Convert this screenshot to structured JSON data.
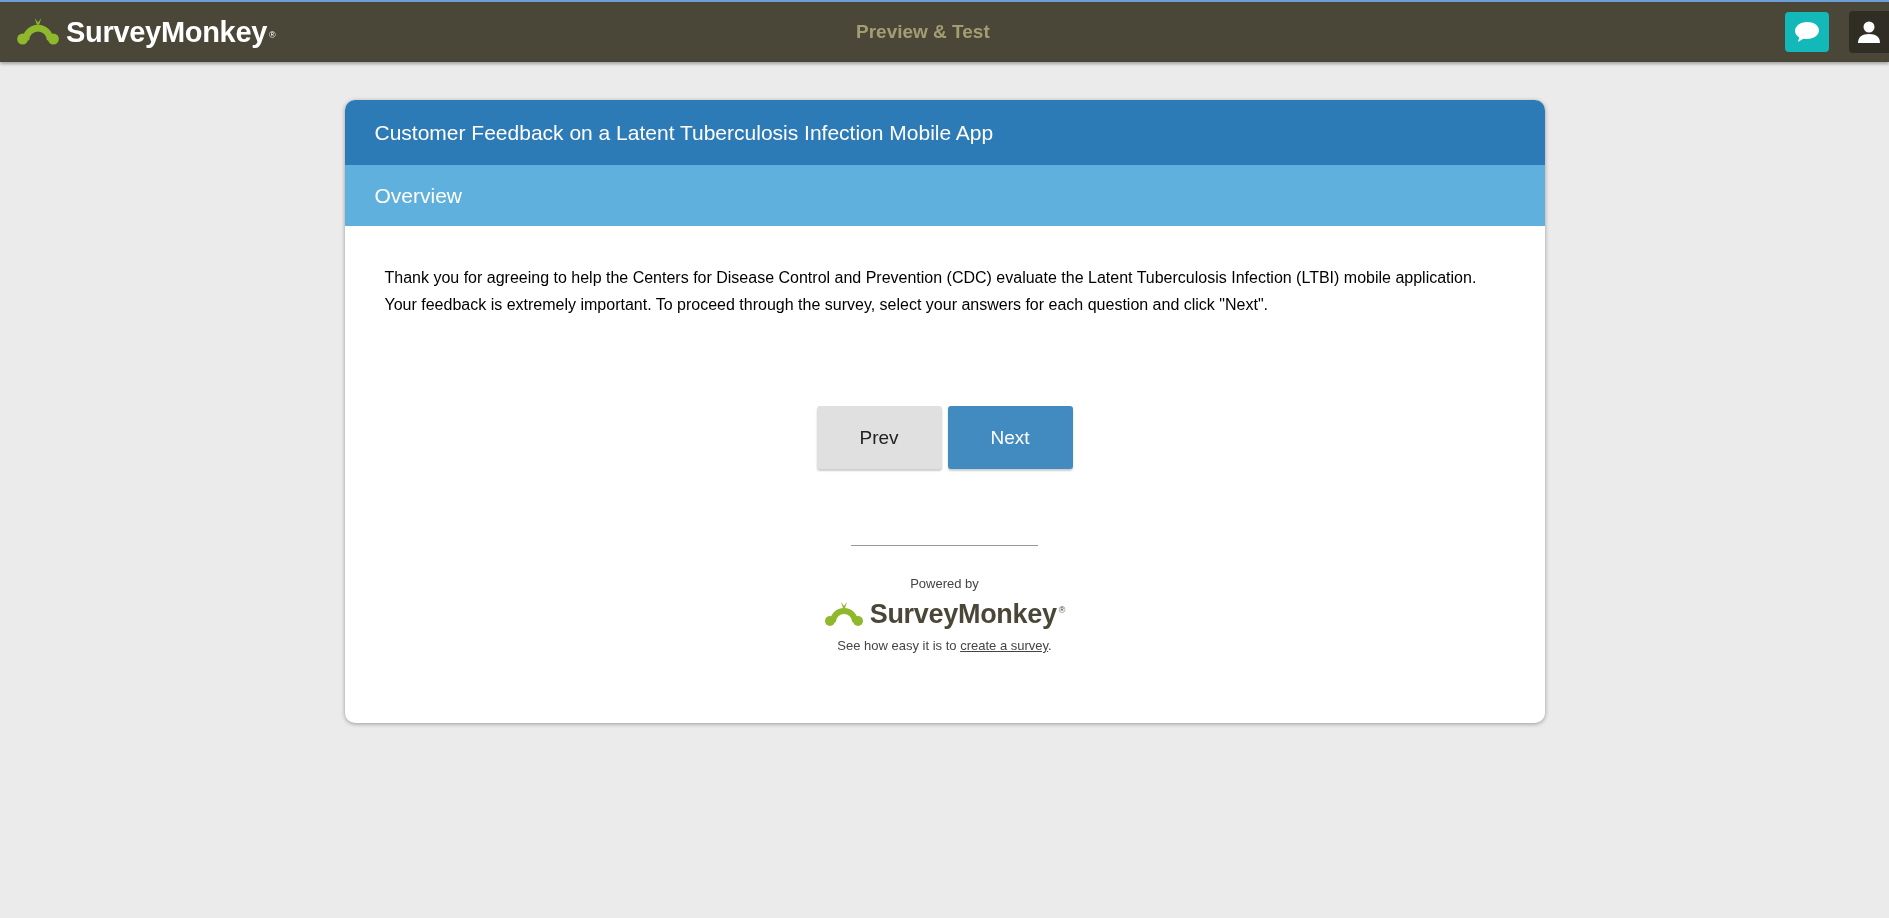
{
  "topbar": {
    "logo": {
      "name": "SurveyMonkey",
      "mark": "®"
    },
    "title": "Preview & Test"
  },
  "survey": {
    "title": "Customer Feedback on a Latent Tuberculosis Infection Mobile App",
    "page_title": "Overview",
    "intro": "Thank you for agreeing to help the Centers for Disease Control and Prevention (CDC) evaluate the Latent Tuberculosis Infection (LTBI) mobile application. Your feedback is extremely important. To proceed through the survey, select your answers for each question and click \"Next\".",
    "buttons": [
      {
        "label": "Prev",
        "kind": "secondary"
      },
      {
        "label": "Next",
        "kind": "primary"
      }
    ],
    "footer": {
      "powered_by": "Powered by",
      "logo": {
        "name": "SurveyMonkey",
        "mark": "®"
      },
      "promo_text": "See how easy it is to",
      "link": "create a survey",
      "suffix": "."
    }
  }
}
